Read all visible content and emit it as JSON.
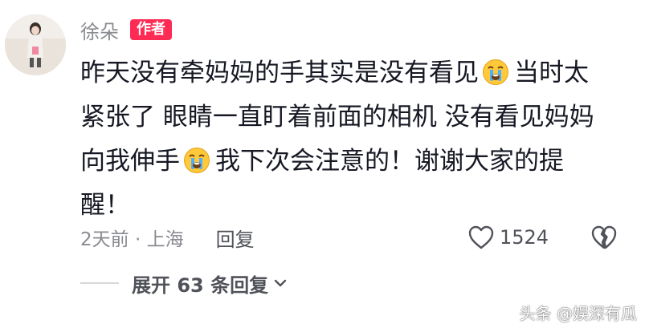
{
  "comment": {
    "username": "徐朵",
    "badge": "作者",
    "line1_a": "昨天没有牵妈妈的手其实是没有看见",
    "line1_b": "当时太",
    "line2": "紧张了 眼睛一直盯着前面的相机 没有看见妈妈",
    "line3_a": "向我伸手",
    "line3_b": "我下次会注意的！谢谢大家的提",
    "line4": "醒！",
    "emoji_icon": "crying-face-icon",
    "time_location": "2天前 · 上海",
    "reply_label": "回复",
    "like_count": "1524",
    "expand_label": "展开 63 条回复"
  },
  "watermark": "头条 @娱深有瓜",
  "colors": {
    "accent": "#fe2c55",
    "secondary_text": "#8a8b91",
    "primary_text": "#161823"
  }
}
